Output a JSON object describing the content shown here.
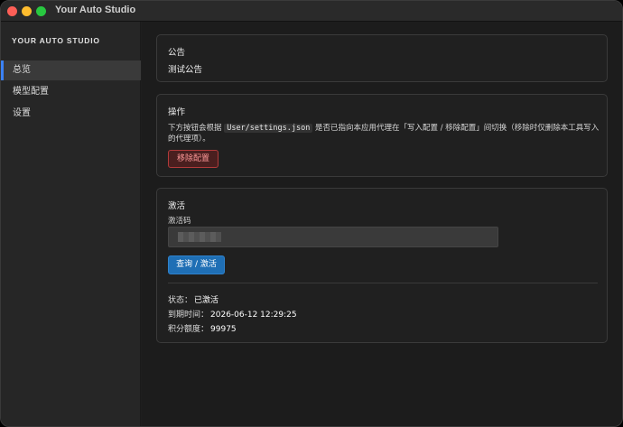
{
  "window": {
    "title": "Your Auto Studio"
  },
  "sidebar": {
    "brand": "YOUR AUTO STUDIO",
    "items": [
      {
        "label": "总览",
        "active": true
      },
      {
        "label": "模型配置",
        "active": false
      },
      {
        "label": "设置",
        "active": false
      }
    ]
  },
  "announcement": {
    "title": "公告",
    "text": "测试公告"
  },
  "operation": {
    "title": "操作",
    "desc_before": "下方按钮会根据 ",
    "path": "User/settings.json",
    "desc_after": " 是否已指向本应用代理在「写入配置 / 移除配置」间切换（移除时仅删除本工具写入的代理项）。",
    "button_label": "移除配置"
  },
  "activation": {
    "title": "激活",
    "code_label": "激活码",
    "button_label": "查询 / 激活",
    "status_label": "状态：",
    "status_value": "已激活",
    "expiry_label": "到期时间：",
    "expiry_value": "2026-06-12 12:29:25",
    "credits_label": "积分额度：",
    "credits_value": "99975"
  },
  "colors": {
    "accent": "#3b82f6",
    "primary_button": "#1f6fb5",
    "danger": "#b23a3a"
  }
}
